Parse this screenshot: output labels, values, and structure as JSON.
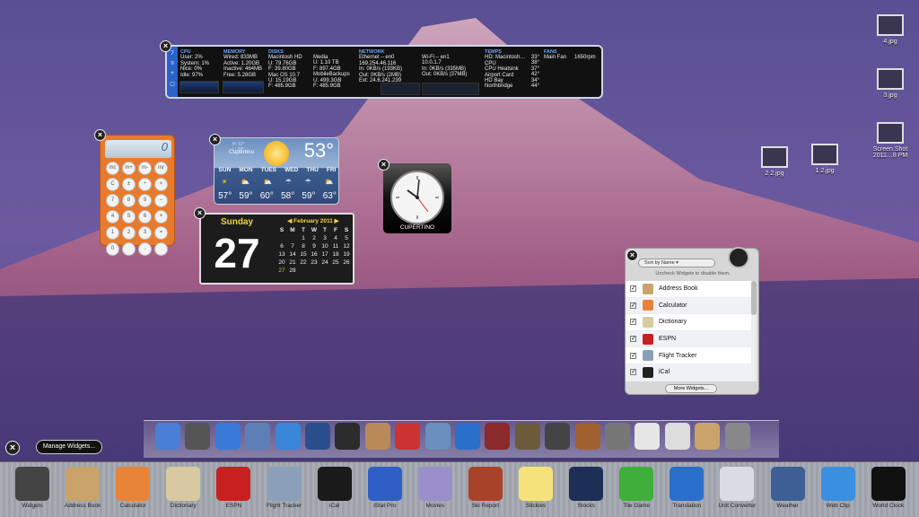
{
  "desktop_icons": [
    {
      "label": "4.jpg"
    },
    {
      "label": "3.jpg"
    },
    {
      "label": "Screen Shot 2011…8 PM"
    },
    {
      "label": "2 2.jpg"
    },
    {
      "label": "1 2.jpg"
    }
  ],
  "istat": {
    "cpu": {
      "title": "CPU",
      "lines": [
        "User: 2%",
        "System: 1%",
        "Nice: 0%",
        "Idle: 97%"
      ]
    },
    "memory": {
      "title": "MEMORY",
      "lines": [
        "Wired: 833MB",
        "Active: 1.20GB",
        "Inactive: 464MB",
        "Free: 5.28GB"
      ]
    },
    "disks": {
      "title": "DISKS",
      "lines": [
        "Macintosh HD",
        "U: 79.76GB",
        "F: 39.80GB",
        "Mac OS 10.7",
        "U: 15.19GB",
        "F: 485.9GB"
      ]
    },
    "media": {
      "lines": [
        "Media",
        "U: 1.10 TB",
        "F: 897.4GB",
        "MobileBackups",
        "U: 499.3GB",
        "F: 485.9GB"
      ]
    },
    "network": {
      "title": "NETWORK",
      "lines": [
        "Ethernet – en0",
        "169.254.46.116",
        "In: 0KB/s (193KB)",
        "Out: 0KB/s (2MB)",
        "Ext: 24.6.241.239"
      ]
    },
    "wifi": {
      "lines": [
        "Wi-Fi – en1",
        "10.0.1.7",
        "In: 0KB/s (335MB)",
        "Out: 0KB/s (37MB)"
      ]
    },
    "temps": {
      "title": "TEMPS",
      "lines": [
        "HD: Macintosh…",
        "CPU",
        "CPU Heatsink",
        "Airport Card",
        "HD Bay",
        "Northbridge"
      ],
      "values": [
        "33°",
        "38°",
        "37°",
        "42°",
        "34°",
        "44°"
      ]
    },
    "fans": {
      "title": "FANS",
      "lines": [
        "Main Fan"
      ],
      "values": [
        "1650rpm"
      ]
    },
    "tabs": [
      "7",
      "≡",
      "+",
      "▢"
    ]
  },
  "calculator": {
    "display": "0",
    "keys": [
      "mc",
      "m+",
      "m-",
      "mr",
      "C",
      "±",
      "÷",
      "×",
      "7",
      "8",
      "9",
      "–",
      "4",
      "5",
      "6",
      "+",
      "1",
      "2",
      "3",
      "=",
      "0",
      "",
      ".",
      " "
    ]
  },
  "weather": {
    "temp": "53°",
    "city": "Cupertino",
    "hi": "H: 57°",
    "lo": "L: 38°",
    "days": [
      "SUN",
      "MON",
      "TUES",
      "WED",
      "THU",
      "FRI"
    ],
    "temps": [
      "57°",
      "59°",
      "60°",
      "58°",
      "59°",
      "63°"
    ]
  },
  "clock": {
    "city": "CUPERTINO"
  },
  "ical": {
    "weekday": "Sunday",
    "date": "27",
    "month": "February 2011",
    "headers": [
      "S",
      "M",
      "T",
      "W",
      "T",
      "F",
      "S"
    ],
    "days": [
      "",
      "",
      "1",
      "2",
      "3",
      "4",
      "5",
      "6",
      "7",
      "8",
      "9",
      "10",
      "11",
      "12",
      "13",
      "14",
      "15",
      "16",
      "17",
      "18",
      "19",
      "20",
      "21",
      "22",
      "23",
      "24",
      "25",
      "26",
      "27",
      "28",
      "",
      "",
      "",
      "",
      ""
    ]
  },
  "manager": {
    "sort": "Sort by Name",
    "hint": "Uncheck Widgets to disable them.",
    "items": [
      {
        "label": "Address Book",
        "color": "#c9a36a"
      },
      {
        "label": "Calculator",
        "color": "#e8833a"
      },
      {
        "label": "Dictionary",
        "color": "#d8c9a0"
      },
      {
        "label": "ESPN",
        "color": "#c8201e"
      },
      {
        "label": "Flight Tracker",
        "color": "#8aa0b8"
      },
      {
        "label": "iCal",
        "color": "#222222"
      }
    ],
    "more": "More Widgets..."
  },
  "manage_button": "Manage Widgets...",
  "widget_bar": [
    {
      "label": "Widgets",
      "color": "#444"
    },
    {
      "label": "Address Book",
      "color": "#c9a36a"
    },
    {
      "label": "Calculator",
      "color": "#e8833a"
    },
    {
      "label": "Dictionary",
      "color": "#d8c9a0"
    },
    {
      "label": "ESPN",
      "color": "#c8201e"
    },
    {
      "label": "Flight Tracker",
      "color": "#8aa0b8"
    },
    {
      "label": "iCal",
      "color": "#1a1a1a"
    },
    {
      "label": "iStat Pro",
      "color": "#2d5fc7"
    },
    {
      "label": "Movies",
      "color": "#9a8fc9"
    },
    {
      "label": "Ski Report",
      "color": "#a8432a"
    },
    {
      "label": "Stickies",
      "color": "#f6e27a"
    },
    {
      "label": "Stocks",
      "color": "#1d2f55"
    },
    {
      "label": "Tile Game",
      "color": "#3fae3a"
    },
    {
      "label": "Translation",
      "color": "#2a6fc9"
    },
    {
      "label": "Unit Converter",
      "color": "#d9dde3"
    },
    {
      "label": "Weather",
      "color": "#3d5f96"
    },
    {
      "label": "Web Clip",
      "color": "#3a8fe0"
    },
    {
      "label": "World Clock",
      "color": "#111"
    }
  ],
  "dock_colors": [
    "#4a7fd8",
    "#555",
    "#3a7ad6",
    "#5d7fb8",
    "#3a86d8",
    "#2b4e8c",
    "#2c2c2c",
    "#b88a5a",
    "#c33",
    "#6b8fbf",
    "#2a6fc9",
    "#8a2a2a",
    "#6b5b3a",
    "#444",
    "#a06030",
    "#777",
    "#e6e6e6",
    "#ddd",
    "#c9a36a",
    "#888"
  ]
}
